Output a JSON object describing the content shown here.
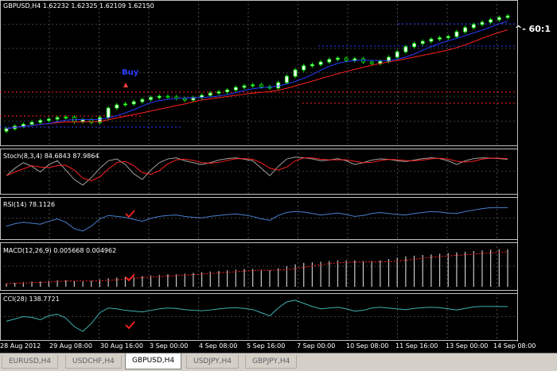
{
  "window": {
    "symbol_header": "GBPUSD,H4  1.62232 1.62325 1.62109 1.62150"
  },
  "annotations": {
    "buy_label": "Buy",
    "ratio_label": "^- 60:1"
  },
  "indicators": {
    "stoch": "Stoch(8,3,4) 84.6843 87.9864",
    "rsi": "RSI(14) 78.1126",
    "macd": "MACD(12,26,9) 0.005668 0.004962",
    "cci": "CCI(28) 138.7721"
  },
  "time_axis": [
    "28 Aug 2012",
    "29 Aug 08:00",
    "30 Aug 16:00",
    "3 Sep 00:00",
    "4 Sep 08:00",
    "5 Sep 16:00",
    "7 Sep 00:00",
    "10 Sep 08:00",
    "11 Sep 16:00",
    "13 Sep 00:00",
    "14 Sep 08:00"
  ],
  "tabs": [
    {
      "label": "EURUSD,H4",
      "active": false
    },
    {
      "label": "USDCHF,H4",
      "active": false
    },
    {
      "label": "GBPUSD,H4",
      "active": true
    },
    {
      "label": "USDJPY,H4",
      "active": false
    },
    {
      "label": "GBPJPY,H4",
      "active": false
    }
  ],
  "colors": {
    "grid": "#7a7a7a",
    "candle_up": "#ffffff",
    "candle_down": "#00ff00",
    "ma_red": "#ff2020",
    "ma_blue": "#2a3cff",
    "stoch_main": "#a0a0a0",
    "stoch_signal": "#ff2020",
    "rsi_line": "#4a7fd0",
    "macd_hist": "#c8c8c8",
    "macd_signal": "#ff2020",
    "cci_line": "#40b0b0",
    "check": "#ff2020",
    "buy": "#2a3cff"
  },
  "chart_data": {
    "type": "candlestick",
    "symbol": "GBPUSD",
    "timeframe": "H4",
    "last_bar": {
      "open": 1.62232,
      "high": 1.62325,
      "low": 1.62109,
      "close": 1.6215
    },
    "close_series": [
      1.586,
      1.5868,
      1.5874,
      1.588,
      1.5886,
      1.589,
      1.5895,
      1.5896,
      1.5882,
      1.5888,
      1.588,
      1.5895,
      1.5925,
      1.5935,
      1.5938,
      1.5945,
      1.5952,
      1.5958,
      1.5962,
      1.596,
      1.5955,
      1.595,
      1.5958,
      1.5965,
      1.5972,
      1.5976,
      1.5982,
      1.599,
      1.5995,
      1.5998,
      1.5992,
      1.5988,
      1.6005,
      1.6025,
      1.6045,
      1.6058,
      1.6062,
      1.607,
      1.6078,
      1.6082,
      1.6075,
      1.608,
      1.607,
      1.6065,
      1.6072,
      1.6085,
      1.6102,
      1.6118,
      1.6128,
      1.6135,
      1.6142,
      1.6146,
      1.615,
      1.6165,
      1.6178,
      1.6188,
      1.6195,
      1.6203,
      1.621,
      1.6215
    ],
    "stoch_main": [
      40,
      60,
      75,
      65,
      50,
      70,
      80,
      55,
      30,
      15,
      35,
      60,
      80,
      85,
      70,
      45,
      30,
      55,
      75,
      85,
      88,
      80,
      75,
      70,
      75,
      82,
      86,
      88,
      84,
      80,
      60,
      40,
      65,
      85,
      90,
      88,
      85,
      80,
      82,
      86,
      80,
      70,
      75,
      82,
      85,
      84,
      80,
      78,
      82,
      86,
      88,
      86,
      80,
      70,
      80,
      86,
      88,
      87,
      86,
      84
    ],
    "rsi": [
      40,
      45,
      48,
      46,
      44,
      50,
      55,
      48,
      35,
      30,
      40,
      55,
      62,
      60,
      58,
      54,
      50,
      56,
      60,
      62,
      63,
      60,
      58,
      57,
      60,
      62,
      64,
      65,
      63,
      60,
      55,
      52,
      62,
      68,
      70,
      69,
      66,
      63,
      65,
      67,
      64,
      60,
      62,
      66,
      68,
      66,
      64,
      63,
      66,
      68,
      70,
      69,
      67,
      66,
      70,
      73,
      76,
      78,
      78,
      78
    ],
    "macd": [
      0.0005,
      0.0006,
      0.0007,
      0.0008,
      0.0008,
      0.0009,
      0.001,
      0.001,
      0.0009,
      0.0008,
      0.0009,
      0.0011,
      0.0013,
      0.0014,
      0.0015,
      0.0015,
      0.0016,
      0.0017,
      0.0018,
      0.0019,
      0.0019,
      0.002,
      0.0021,
      0.0022,
      0.0023,
      0.0024,
      0.0025,
      0.0026,
      0.0027,
      0.0027,
      0.0026,
      0.0025,
      0.0028,
      0.0031,
      0.0034,
      0.0036,
      0.0037,
      0.0038,
      0.0039,
      0.004,
      0.004,
      0.004,
      0.0039,
      0.0039,
      0.004,
      0.0042,
      0.0044,
      0.0046,
      0.0047,
      0.0048,
      0.0049,
      0.005,
      0.0051,
      0.0052,
      0.0053,
      0.0054,
      0.0055,
      0.0056,
      0.005668,
      0.005668
    ],
    "cci": [
      -50,
      -20,
      10,
      0,
      -30,
      20,
      40,
      -10,
      -120,
      -180,
      -80,
      60,
      120,
      110,
      90,
      80,
      70,
      90,
      110,
      120,
      115,
      100,
      90,
      85,
      95,
      110,
      120,
      125,
      115,
      100,
      60,
      20,
      120,
      200,
      220,
      180,
      140,
      110,
      120,
      130,
      110,
      80,
      90,
      120,
      130,
      120,
      110,
      100,
      115,
      125,
      130,
      125,
      110,
      95,
      115,
      135,
      140,
      140,
      139,
      138.7721
    ]
  }
}
